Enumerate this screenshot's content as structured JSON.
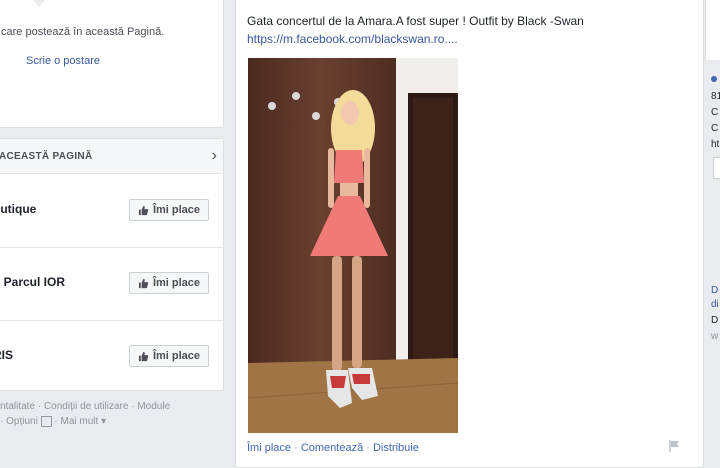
{
  "left": {
    "top_card": {
      "info_text": "care postează în această Pagină.",
      "write_post": "Scrie o postare"
    },
    "like_section": {
      "title": "ACEASTĂ PAGINĂ",
      "pages": [
        {
          "name": "outique",
          "button": "Îmi place"
        },
        {
          "name": "ti Parcul IOR",
          "button": "Îmi place"
        },
        {
          "name": "RIS",
          "button": "Îmi place"
        }
      ]
    },
    "footer": {
      "line1": [
        "ntalitate",
        "Condiții de utilizare",
        "Module"
      ],
      "line2": [
        "Opțiuni",
        "Mai mult"
      ],
      "dot": "·"
    }
  },
  "post": {
    "text": "Gata concertul de la Amara.A fost super ! Outfit by Black -Swan",
    "link": "https://m.facebook.com/blackswan.ro....",
    "actions": [
      "Îmi place",
      "Comentează",
      "Distribuie"
    ],
    "separator": " · "
  },
  "right": {
    "lines_top": [
      "81",
      "C",
      "C",
      "ht"
    ],
    "lines_bottom": [
      "D",
      "di",
      "D",
      "w"
    ]
  },
  "colors": {
    "link": "#365899",
    "action": "#4267b2",
    "background": "#e9ebee",
    "dress": "#f07a78"
  }
}
